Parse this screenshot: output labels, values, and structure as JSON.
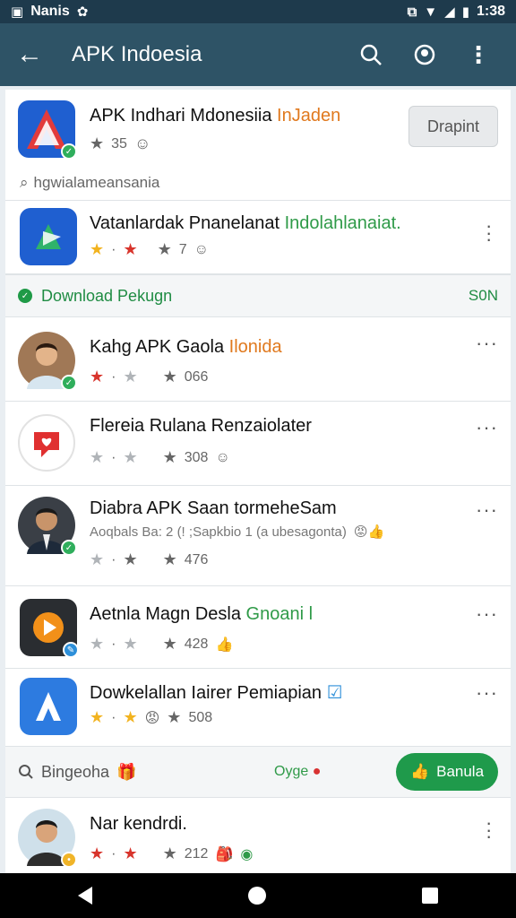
{
  "status_bar": {
    "carrier": "Nanis",
    "time": "1:38"
  },
  "app_bar": {
    "title": "APK Indoesia"
  },
  "featured": {
    "name_main": "APK Indhari Mdonesiia ",
    "name_hl": "InJaden",
    "rating": "35",
    "button": "Drapint",
    "search_hint": "hgwialameansania"
  },
  "app2": {
    "name_main": "Vatanlardak Pnanelanat ",
    "name_hl": "Indolahlanaiat.",
    "rating": "7"
  },
  "download_bar": {
    "label": "Download Pekugn",
    "count": "S0N"
  },
  "list": [
    {
      "name_main": "Kahg APK Gaola ",
      "name_hl": "Ilonida",
      "rating": "066"
    },
    {
      "name_main": "Flereia Rulana Renzaiolater",
      "name_hl": "",
      "rating": "308"
    },
    {
      "name_main": "Diabra APK Saan ",
      "name_hl": "tormeheSam",
      "subtitle": "Aoqbals Ba: 2 (! ;Sapkbio 1 (a ubesagonta)",
      "rating": "476"
    },
    {
      "name_main": "Aetnla Magn Desla ",
      "name_hl": "Gnoani l",
      "rating": "428"
    },
    {
      "name_main": "Dowkelallan Iairer Pemiapian",
      "name_hl": "",
      "rating": "508"
    }
  ],
  "bottom_bar": {
    "query": "Bingeoha",
    "middle": "Oyge",
    "button": "Banula"
  },
  "last": {
    "name_main": "Nar kendrdi.",
    "rating": "212"
  }
}
